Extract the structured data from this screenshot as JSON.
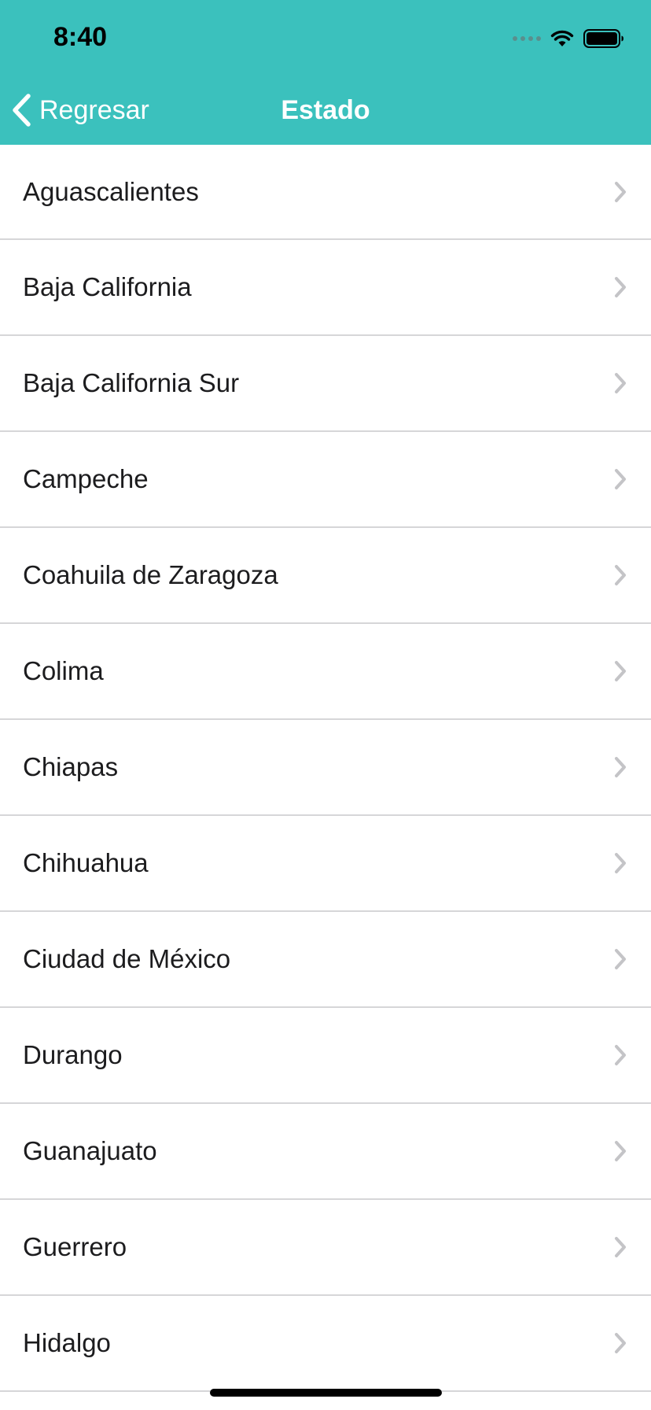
{
  "status_bar": {
    "time": "8:40",
    "icons": [
      "cellular-dots-icon",
      "wifi-icon",
      "battery-icon"
    ]
  },
  "nav": {
    "back_label": "Regresar",
    "title": "Estado",
    "background_color": "#3bc1bd"
  },
  "states": [
    {
      "label": "Aguascalientes"
    },
    {
      "label": "Baja California"
    },
    {
      "label": "Baja California Sur"
    },
    {
      "label": "Campeche"
    },
    {
      "label": "Coahuila de Zaragoza"
    },
    {
      "label": "Colima"
    },
    {
      "label": "Chiapas"
    },
    {
      "label": "Chihuahua"
    },
    {
      "label": "Ciudad de México"
    },
    {
      "label": "Durango"
    },
    {
      "label": "Guanajuato"
    },
    {
      "label": "Guerrero"
    },
    {
      "label": "Hidalgo"
    }
  ]
}
